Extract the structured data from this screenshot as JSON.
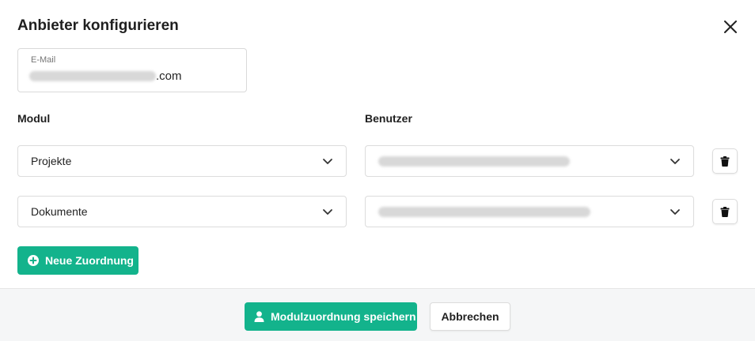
{
  "dialog": {
    "title": "Anbieter konfigurieren",
    "close_icon": "close-icon"
  },
  "email": {
    "label": "E-Mail",
    "value_visible_suffix": ".com"
  },
  "columns": {
    "modul": "Modul",
    "benutzer": "Benutzer"
  },
  "rows": [
    {
      "modul": "Projekte"
    },
    {
      "modul": "Dokumente"
    }
  ],
  "actions": {
    "add_label": "Neue Zuordnung",
    "save_label": "Modulzuordnung speichern",
    "cancel_label": "Abbrechen"
  },
  "colors": {
    "accent": "#13b38c",
    "footer_bg": "#f5f6f7"
  }
}
